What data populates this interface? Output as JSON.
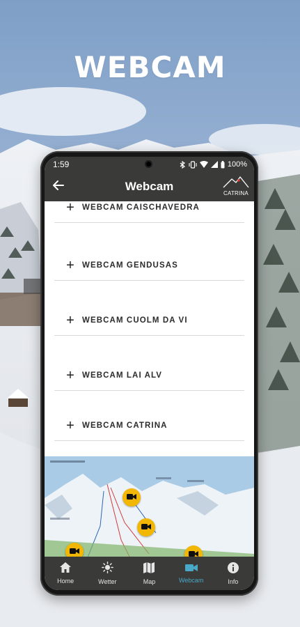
{
  "hero": {
    "title": "WEBCAM"
  },
  "status": {
    "time": "1:59",
    "battery": "100%"
  },
  "appbar": {
    "title": "Webcam",
    "brand": "CATRINA"
  },
  "webcams": [
    {
      "label": "WEBCAM CAISCHAVEDRA"
    },
    {
      "label": "WEBCAM GENDUSAS"
    },
    {
      "label": "WEBCAM CUOLM DA VI"
    },
    {
      "label": "WEBCAM LAI ALV"
    },
    {
      "label": "WEBCAM CATRINA"
    }
  ],
  "nav": [
    {
      "label": "Home",
      "icon": "home-icon"
    },
    {
      "label": "Wetter",
      "icon": "sun-icon"
    },
    {
      "label": "Map",
      "icon": "map-icon"
    },
    {
      "label": "Webcam",
      "icon": "video-camera-icon",
      "active": true
    },
    {
      "label": "Info",
      "icon": "info-icon"
    }
  ],
  "colors": {
    "bar": "#3a3a39",
    "accent": "#4aa8c8",
    "marker": "#f2b705"
  }
}
